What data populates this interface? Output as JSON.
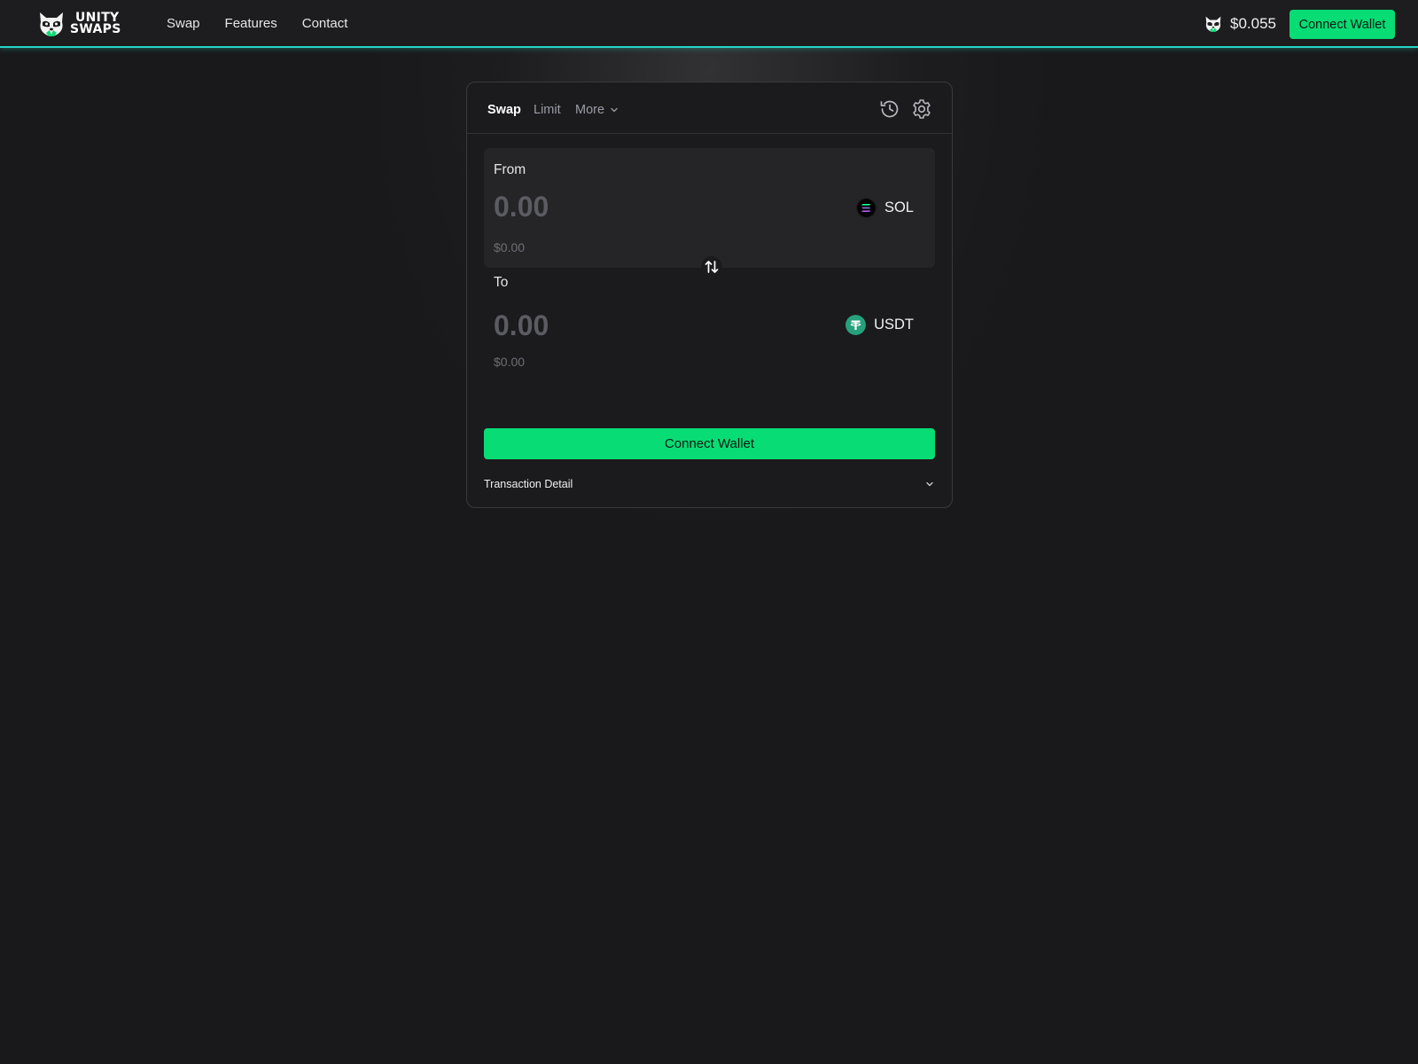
{
  "brand": {
    "name_line1": "UNITY",
    "name_line2": "SWAPS",
    "logo_icon": "raccoon-mascot-icon"
  },
  "nav": {
    "items": [
      {
        "label": "Swap"
      },
      {
        "label": "Features"
      },
      {
        "label": "Contact"
      }
    ]
  },
  "header": {
    "token_price": "$0.055",
    "token_price_icon": "raccoon-mascot-icon",
    "connect_label": "Connect Wallet"
  },
  "swap_card": {
    "tabs": {
      "swap": "Swap",
      "limit": "Limit",
      "more": "More"
    },
    "active_tab": "Swap",
    "icons": [
      "history-icon",
      "settings-gear-icon"
    ],
    "from": {
      "label": "From",
      "amount_placeholder": "0.00",
      "usd_value": "$0.00",
      "token": "SOL",
      "token_icon": "solana-icon"
    },
    "to": {
      "label": "To",
      "amount_placeholder": "0.00",
      "usd_value": "$0.00",
      "token": "USDT",
      "token_icon": "tether-icon"
    },
    "swap_direction_icon": "swap-arrows-icon",
    "connect_label": "Connect Wallet",
    "transaction_detail_label": "Transaction Detail"
  },
  "colors": {
    "accent_green": "#08dc74",
    "header_border_cyan": "#24d6c8",
    "background": "#19191b",
    "card": "#1b1b1d",
    "tether_green": "#26a17b"
  }
}
